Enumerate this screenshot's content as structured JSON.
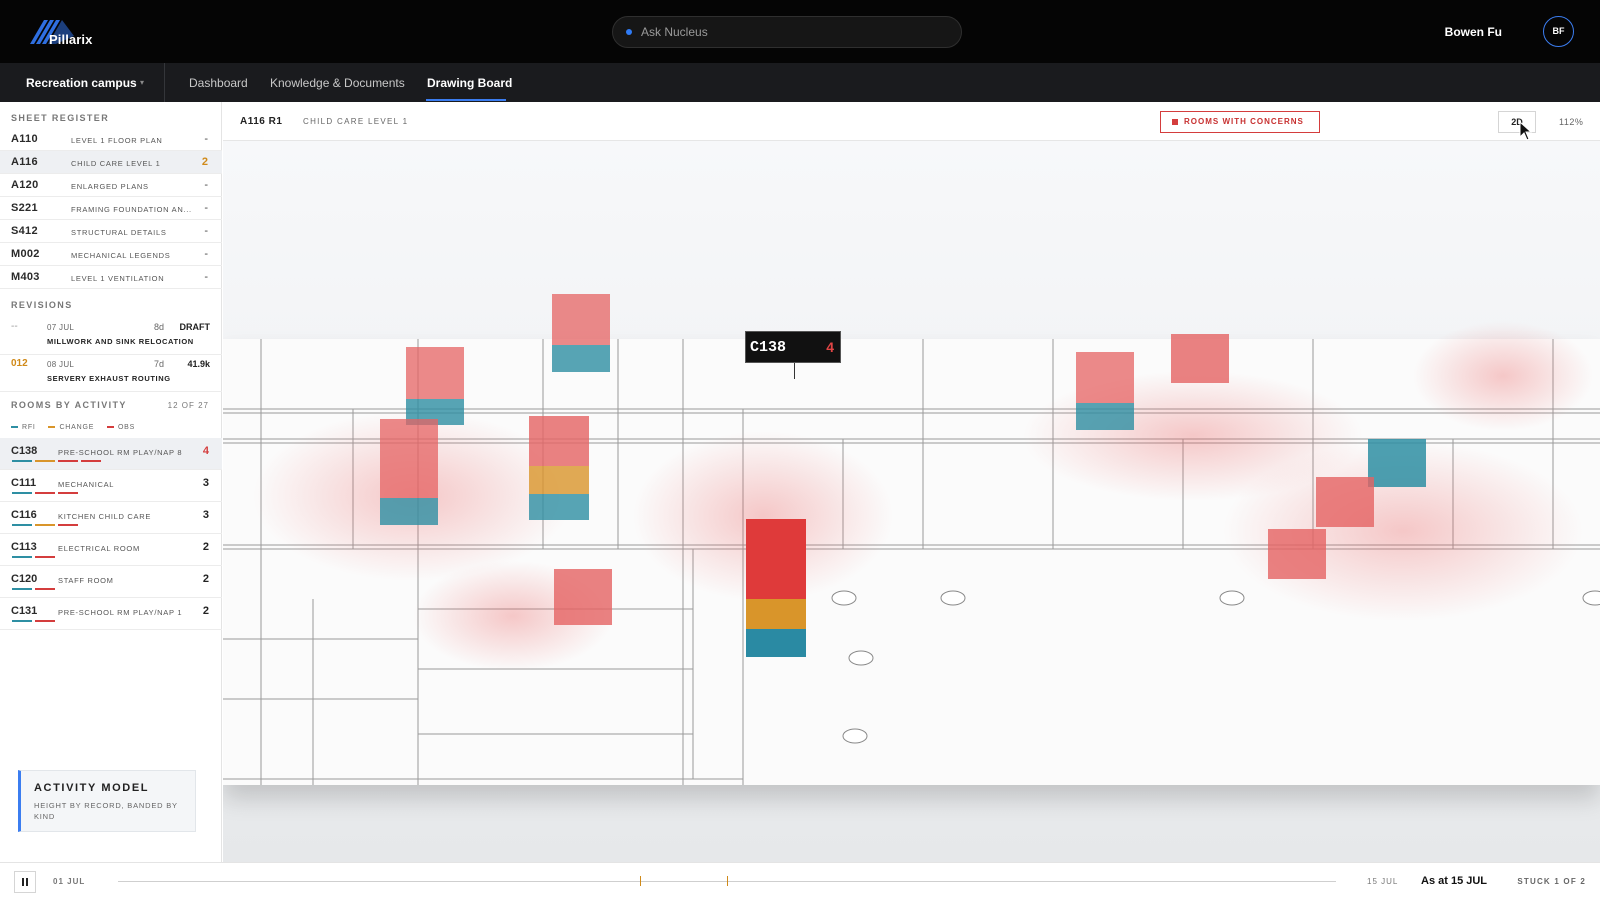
{
  "app": {
    "name": "Pillarix"
  },
  "search": {
    "placeholder": "Ask Nucleus"
  },
  "user": {
    "name": "Bowen Fu",
    "initials": "BF"
  },
  "nav": {
    "project": "Recreation campus",
    "tabs": [
      {
        "label": "Dashboard"
      },
      {
        "label": "Knowledge & Documents"
      },
      {
        "label": "Drawing Board",
        "active": true
      }
    ]
  },
  "sheet_register": {
    "title": "SHEET REGISTER",
    "rows": [
      {
        "code": "A110",
        "name": "LEVEL 1 FLOOR PLAN",
        "value": "-"
      },
      {
        "code": "A116",
        "name": "CHILD CARE LEVEL 1",
        "value": "2",
        "selected": true
      },
      {
        "code": "A120",
        "name": "ENLARGED PLANS",
        "value": "-"
      },
      {
        "code": "S221",
        "name": "FRAMING FOUNDATION AN...",
        "value": "-"
      },
      {
        "code": "S412",
        "name": "STRUCTURAL DETAILS",
        "value": "-"
      },
      {
        "code": "M002",
        "name": "MECHANICAL LEGENDS",
        "value": "-"
      },
      {
        "code": "M403",
        "name": "LEVEL 1 VENTILATION",
        "value": "-"
      }
    ]
  },
  "revisions": {
    "title": "REVISIONS",
    "rows": [
      {
        "code": "--",
        "date": "07 JUL",
        "age": "8d",
        "status": "DRAFT",
        "desc": "MILLWORK AND SINK RELOCATION"
      },
      {
        "code": "012",
        "date": "08 JUL",
        "age": "7d",
        "status": "41.9k",
        "desc": "SERVERY EXHAUST ROUTING"
      }
    ]
  },
  "rooms_by_activity": {
    "title": "ROOMS BY ACTIVITY",
    "count": "12 OF 27",
    "legend": [
      {
        "label": "RFI",
        "color": "#2e8fa3"
      },
      {
        "label": "CHANGE",
        "color": "#d9952a"
      },
      {
        "label": "OBS",
        "color": "#d43d3d"
      }
    ],
    "rows": [
      {
        "code": "C138",
        "name": "PRE-SCHOOL RM PLAY/NAP 8",
        "count": "4",
        "selected": true,
        "bars": [
          "#2e8fa3",
          "#d9952a",
          "#d43d3d",
          "#d43d3d"
        ]
      },
      {
        "code": "C111",
        "name": "MECHANICAL",
        "count": "3",
        "bars": [
          "#2e8fa3",
          "#d43d3d",
          "#d43d3d"
        ]
      },
      {
        "code": "C116",
        "name": "KITCHEN CHILD CARE",
        "count": "3",
        "bars": [
          "#2e8fa3",
          "#d9952a",
          "#d43d3d"
        ]
      },
      {
        "code": "C113",
        "name": "ELECTRICAL ROOM",
        "count": "2",
        "bars": [
          "#2e8fa3",
          "#d43d3d"
        ]
      },
      {
        "code": "C120",
        "name": "STAFF ROOM",
        "count": "2",
        "bars": [
          "#2e8fa3",
          "#d43d3d"
        ]
      },
      {
        "code": "C131",
        "name": "PRE-SCHOOL RM PLAY/NAP 1",
        "count": "2",
        "bars": [
          "#2e8fa3",
          "#d43d3d"
        ]
      }
    ]
  },
  "activity_model": {
    "title": "ACTIVITY MODEL",
    "desc": "HEIGHT BY RECORD, BANDED BY KIND"
  },
  "sheet_header": {
    "code": "A116 R1",
    "name": "CHILD CARE LEVEL 1",
    "concern_button": "ROOMS WITH CONCERNS",
    "view_mode": "2D",
    "zoom": "112%"
  },
  "tooltip": {
    "room": "C138",
    "count": "4"
  },
  "timeline": {
    "start": "01 JUL",
    "end": "15 JUL",
    "as_at": "As at 15 JUL",
    "stuck": "STUCK 1 OF 2"
  },
  "colors": {
    "rfi": "#2e8fa3",
    "change": "#d9952a",
    "obs": "#d43d3d",
    "accent": "#3b7df0"
  }
}
